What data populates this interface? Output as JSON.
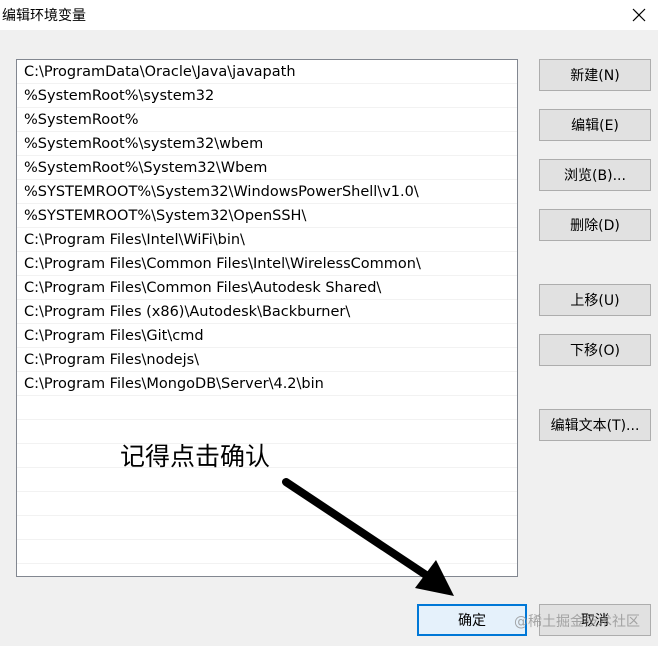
{
  "window": {
    "title": "编辑环境变量",
    "close_icon": "close-icon"
  },
  "path_list": {
    "items": [
      "C:\\ProgramData\\Oracle\\Java\\javapath",
      "%SystemRoot%\\system32",
      "%SystemRoot%",
      "%SystemRoot%\\system32\\wbem",
      "%SystemRoot%\\System32\\Wbem",
      "%SYSTEMROOT%\\System32\\WindowsPowerShell\\v1.0\\",
      "%SYSTEMROOT%\\System32\\OpenSSH\\",
      "C:\\Program Files\\Intel\\WiFi\\bin\\",
      "C:\\Program Files\\Common Files\\Intel\\WirelessCommon\\",
      "C:\\Program Files\\Common Files\\Autodesk Shared\\",
      "C:\\Program Files (x86)\\Autodesk\\Backburner\\",
      "C:\\Program Files\\Git\\cmd",
      "C:\\Program Files\\nodejs\\",
      "C:\\Program Files\\MongoDB\\Server\\4.2\\bin"
    ]
  },
  "buttons": {
    "new": "新建(N)",
    "edit": "编辑(E)",
    "browse": "浏览(B)...",
    "delete": "删除(D)",
    "move_up": "上移(U)",
    "move_down": "下移(O)",
    "edit_text": "编辑文本(T)...",
    "ok": "确定",
    "cancel": "取消"
  },
  "annotation": {
    "text": "记得点击确认"
  },
  "watermark": {
    "text": "@稀土掘金技术社区"
  },
  "colors": {
    "accent": "#0078d7"
  }
}
